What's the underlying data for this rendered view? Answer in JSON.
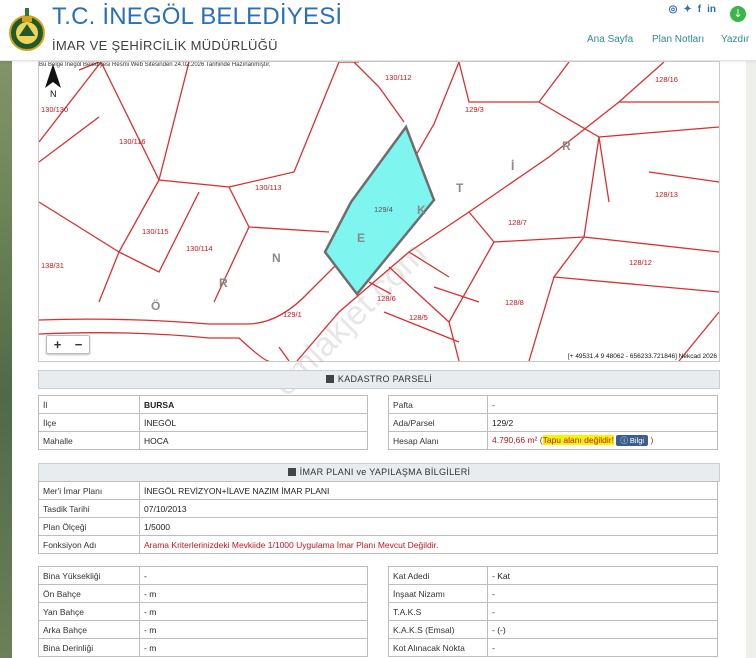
{
  "header": {
    "title": "T.C. İNEGÖL BELEDİYESİ",
    "subtitle": "İMAR VE ŞEHİRCİLİK MÜDÜRLÜĞÜ",
    "nav": [
      "Ana Sayfa",
      "Plan Notları",
      "Yazdır"
    ],
    "social_icons": [
      "instagram-icon",
      "twitter-icon",
      "facebook-icon",
      "linkedin-icon"
    ],
    "download_icon": "download-icon"
  },
  "map": {
    "note": "Bu Belge İnegöl Belediyesi Resmi Web Sitesinden 24.02.2026 Tarihinde Hazırlanmıştır.",
    "coords": "[+ 49531.4 9 48062 - 656233.721846] Nekcad 2026",
    "zoom_in": "+",
    "zoom_out": "−",
    "north": "N",
    "street_letters": [
      "Ö",
      "R",
      "N",
      "E",
      "K",
      "T",
      "İ",
      "R"
    ],
    "parcels": [
      "130/130",
      "130/112",
      "129/3",
      "128/16",
      "130/116",
      "130/113",
      "129/4",
      "128/13",
      "130/115",
      "130/114",
      "128/7",
      "138/31",
      "128/12",
      "129/1",
      "128/6",
      "128/5",
      "128/8"
    ],
    "colors": {
      "highlight": "#7ff5f0",
      "parcel_line": "#d9302f",
      "highlight_border": "#6e6e6e"
    }
  },
  "watermark": "emlakjet.com",
  "kadastro": {
    "title": "KADASTRO PARSELİ",
    "left": [
      {
        "key": "İl",
        "value": "BURSA"
      },
      {
        "key": "İlçe",
        "value": "İNEGÖL"
      },
      {
        "key": "Mahalle",
        "value": "HOCA"
      }
    ],
    "right": [
      {
        "key": "Pafta",
        "value": "-"
      },
      {
        "key": "Ada/Parsel",
        "value": "129/2"
      },
      {
        "key": "Hesap Alanı",
        "value": "4.790,66 m²",
        "note_open": "(",
        "note": "Tapu alanı değildir!",
        "button": "Bilgi",
        "note_close": ")"
      }
    ]
  },
  "imar": {
    "title": "İMAR PLANI ve YAPILAŞMA BİLGİLERİ",
    "rows": [
      {
        "key": "Mer'i İmar Planı",
        "value": "İNEGÖL REVİZYON+İLAVE NAZIM İMAR PLANI"
      },
      {
        "key": "Tasdik Tarihi",
        "value": "07/10/2013"
      },
      {
        "key": "Plan Ölçeği",
        "value": "1/5000"
      },
      {
        "key": "Fonksiyon Adı",
        "value": "Arama Kriterlerinizdeki Mevkiide 1/1000 Uygulama İmar Planı Mevcut Değildir."
      }
    ]
  },
  "yapi": {
    "left": [
      {
        "key": "Bina Yüksekliği",
        "value": "-"
      },
      {
        "key": "Ön Bahçe",
        "value": "- m"
      },
      {
        "key": "Yan Bahçe",
        "value": "- m"
      },
      {
        "key": "Arka Bahçe",
        "value": "- m"
      },
      {
        "key": "Bina Derinliği",
        "value": "- m"
      }
    ],
    "right": [
      {
        "key": "Kat Adedi",
        "value": "- Kat"
      },
      {
        "key": "İnşaat Nizamı",
        "value": "-"
      },
      {
        "key": "T.A.K.S",
        "value": "-"
      },
      {
        "key": "K.A.K.S (Emsal)",
        "value": "- (-)"
      },
      {
        "key": "Kot Alınacak Nokta",
        "value": "-"
      }
    ]
  }
}
